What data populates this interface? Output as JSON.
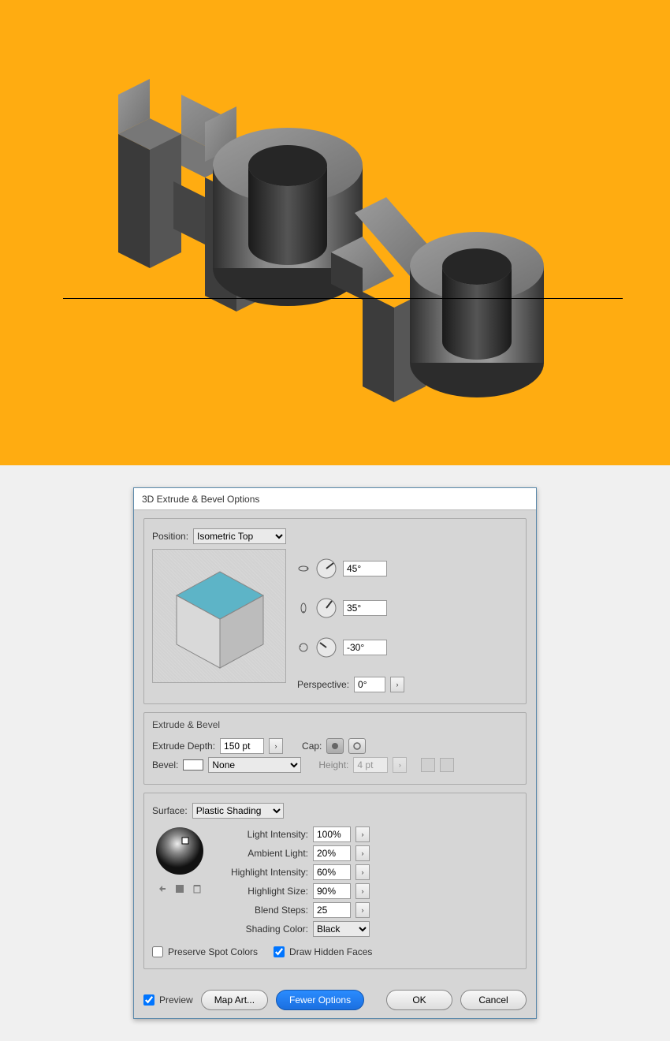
{
  "dialog": {
    "title": "3D Extrude & Bevel Options",
    "position": {
      "label": "Position:",
      "value": "Isometric Top",
      "rot_x": "45°",
      "rot_y": "35°",
      "rot_z": "-30°",
      "perspective_label": "Perspective:",
      "perspective_value": "0°"
    },
    "extrude": {
      "section_label": "Extrude & Bevel",
      "depth_label": "Extrude Depth:",
      "depth_value": "150 pt",
      "cap_label": "Cap:",
      "bevel_label": "Bevel:",
      "bevel_value": "None",
      "height_label": "Height:",
      "height_value": "4 pt"
    },
    "surface": {
      "label": "Surface:",
      "value": "Plastic Shading",
      "light_intensity_label": "Light Intensity:",
      "light_intensity_value": "100%",
      "ambient_label": "Ambient Light:",
      "ambient_value": "20%",
      "hi_intensity_label": "Highlight Intensity:",
      "hi_intensity_value": "60%",
      "hi_size_label": "Highlight Size:",
      "hi_size_value": "90%",
      "blend_label": "Blend Steps:",
      "blend_value": "25",
      "shading_color_label": "Shading Color:",
      "shading_color_value": "Black",
      "preserve_spot": "Preserve Spot Colors",
      "draw_hidden": "Draw Hidden Faces"
    },
    "footer": {
      "preview": "Preview",
      "map_art": "Map Art...",
      "fewer": "Fewer Options",
      "ok": "OK",
      "cancel": "Cancel"
    }
  }
}
